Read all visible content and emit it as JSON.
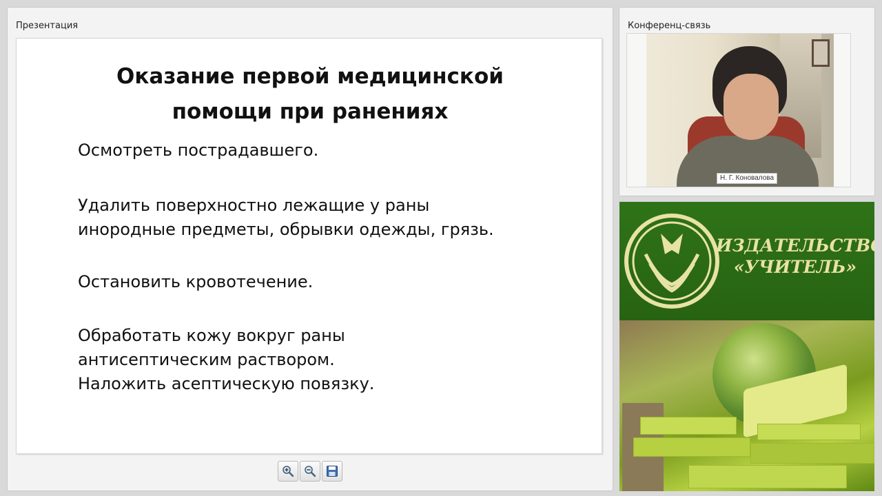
{
  "presentation": {
    "panel_title": "Презентация",
    "slide": {
      "title": "Оказание первой медицинской\nпомощи при ранениях",
      "items": [
        "Осмотреть пострадавшего.",
        "Удалить поверхностно лежащие у раны\nинородные предметы, обрывки одежды, грязь.",
        "Остановить кровотечение.",
        "Обработать кожу вокруг раны\nантисептическим раствором.\nНаложить асептическую повязку."
      ]
    },
    "toolbar": {
      "zoom_in_icon": "zoom-in-icon",
      "zoom_out_icon": "zoom-out-icon",
      "save_icon": "save-icon"
    }
  },
  "conference": {
    "panel_title": "Конференц-связь",
    "speaker_label": "Н. Г. Коновалова"
  },
  "promo": {
    "publisher_name": "ИЗДАТЕЛЬСТВО\n«УЧИТЕЛЬ»",
    "colors": {
      "background": "#2e6d17",
      "text": "#e8e2a5"
    }
  }
}
